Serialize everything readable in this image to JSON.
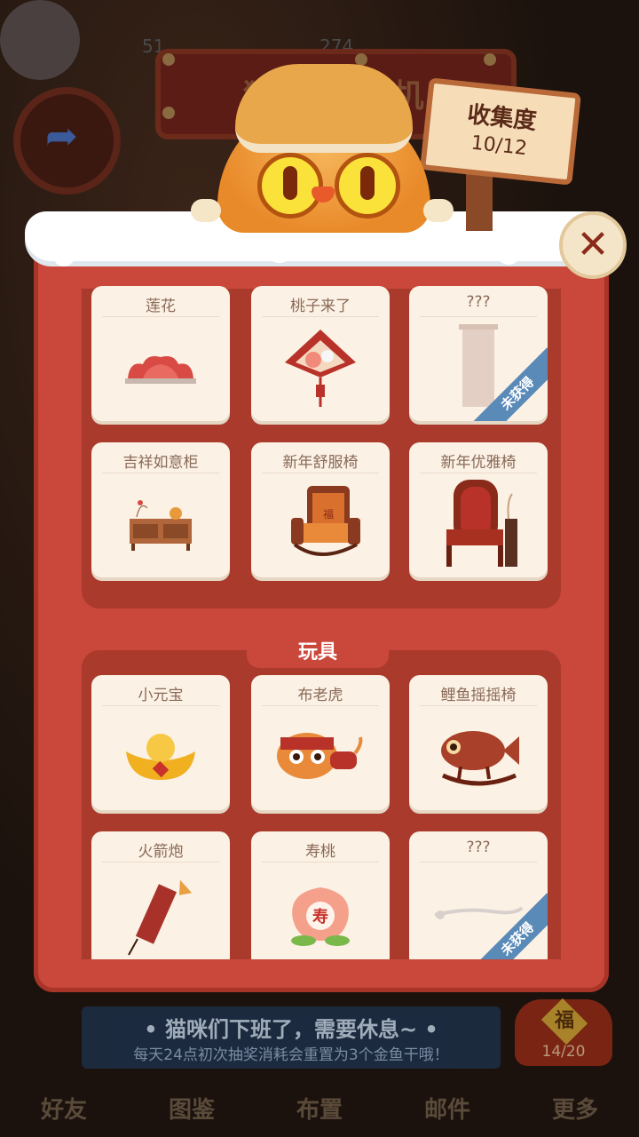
{
  "background": {
    "banner_text": "猫咪扭蛋机",
    "stats_left": "51",
    "stats_right": "274",
    "bottom_notice_line1": "• 猫咪们下班了，需要休息~ •",
    "bottom_notice_line2": "每天24点初次抽奖消耗会重置为3个金鱼干哦！",
    "lucky_bag_char": "福",
    "lucky_bag_count": "14/20",
    "nav": [
      "好友",
      "图鉴",
      "布置",
      "邮件",
      "更多"
    ]
  },
  "sign": {
    "title": "收集度",
    "value": "10/12"
  },
  "close_label": "✕",
  "section1": {
    "cards": [
      {
        "title": "莲花",
        "icon": "lotus-icon",
        "locked": false
      },
      {
        "title": "桃子来了",
        "icon": "peach-ornament-icon",
        "locked": false
      },
      {
        "title": "???",
        "icon": "scroll-placeholder-icon",
        "locked": true,
        "badge": "未获得"
      },
      {
        "title": "吉祥如意柜",
        "icon": "cabinet-icon",
        "locked": false
      },
      {
        "title": "新年舒服椅",
        "icon": "armchair-icon",
        "locked": false
      },
      {
        "title": "新年优雅椅",
        "icon": "elegant-chair-icon",
        "locked": false
      }
    ]
  },
  "section2": {
    "header": "玩具",
    "cards": [
      {
        "title": "小元宝",
        "icon": "gold-ingot-icon",
        "locked": false
      },
      {
        "title": "布老虎",
        "icon": "cloth-tiger-icon",
        "locked": false
      },
      {
        "title": "鲤鱼摇摇椅",
        "icon": "carp-rocker-icon",
        "locked": false
      },
      {
        "title": "火箭炮",
        "icon": "firecracker-icon",
        "locked": false
      },
      {
        "title": "寿桃",
        "icon": "longevity-peach-icon",
        "locked": false
      },
      {
        "title": "???",
        "icon": "placeholder-icon",
        "locked": true,
        "badge": "未获得"
      }
    ]
  },
  "peach_char": "寿",
  "chair_char": "福"
}
